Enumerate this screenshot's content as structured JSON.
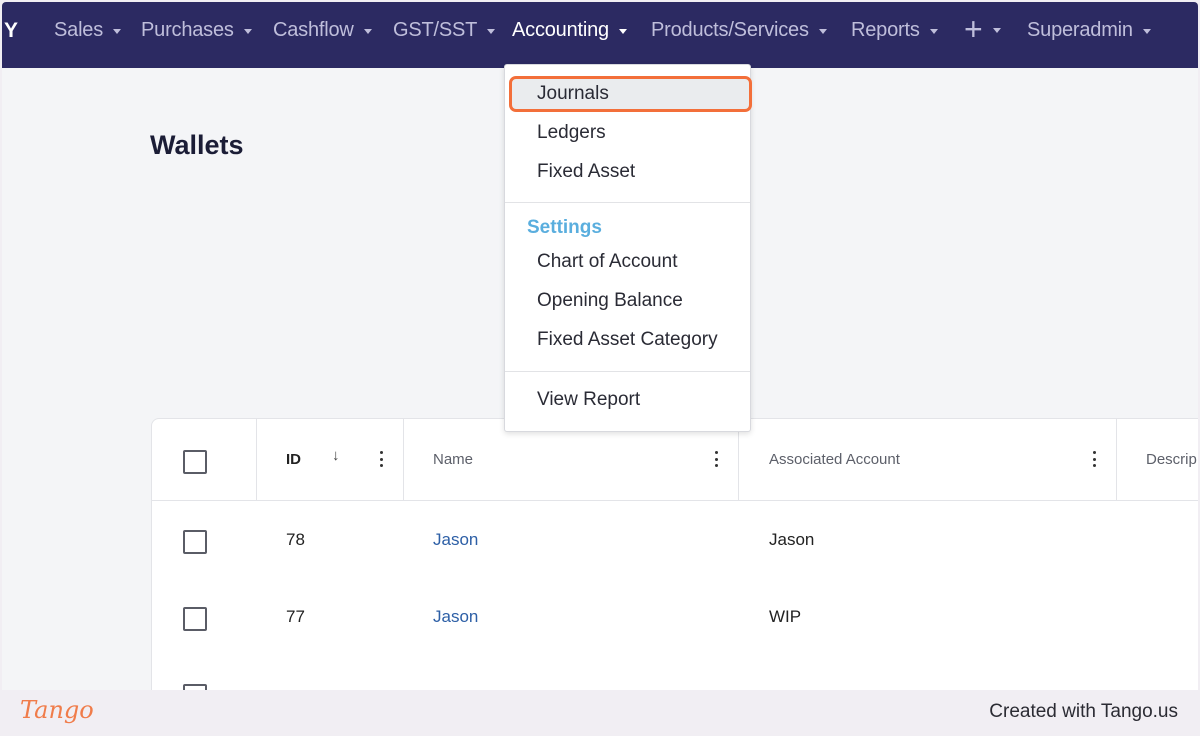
{
  "navbar": {
    "brand": "Y",
    "items": [
      {
        "label": "Sales"
      },
      {
        "label": "Purchases"
      },
      {
        "label": "Cashflow"
      },
      {
        "label": "GST/SST"
      },
      {
        "label": "Accounting"
      },
      {
        "label": "Products/Services"
      },
      {
        "label": "Reports"
      },
      {
        "label": "+"
      },
      {
        "label": "Superadmin"
      }
    ],
    "active": "Accounting"
  },
  "page": {
    "title": "Wallets"
  },
  "dropdown": {
    "items": [
      "Journals",
      "Ledgers",
      "Fixed Asset"
    ],
    "settings_header": "Settings",
    "settings_items": [
      "Chart of Account",
      "Opening Balance",
      "Fixed Asset Category"
    ],
    "report_item": "View Report",
    "highlighted": "Journals",
    "highlight_color": "#f36f3a"
  },
  "table": {
    "columns": [
      "ID",
      "Name",
      "Associated Account",
      "Descrip"
    ],
    "sort_icon": "arrow-down-icon",
    "rows": [
      {
        "id": "78",
        "name": "Jason",
        "account": "Jason"
      },
      {
        "id": "77",
        "name": "Jason",
        "account": "WIP"
      }
    ]
  },
  "footer": {
    "logo": "Tango",
    "credit": "Created with Tango.us"
  },
  "colors": {
    "navbar": "#2c2a62",
    "link": "#2d5fa6",
    "section": "#5aaede"
  }
}
